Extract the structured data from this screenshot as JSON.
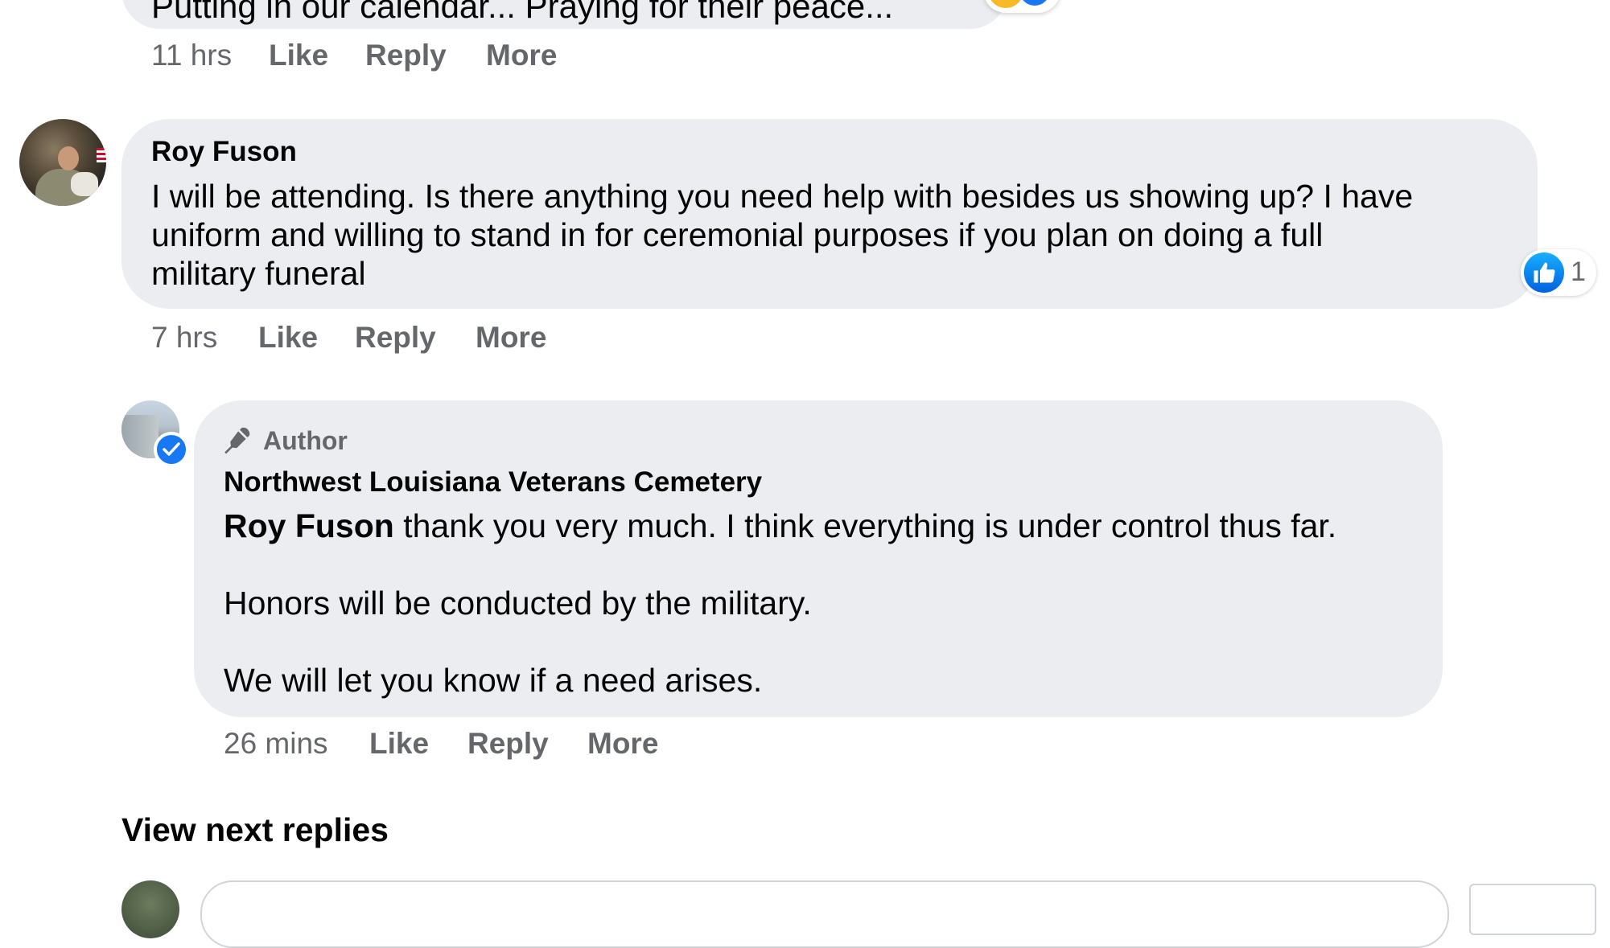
{
  "previous_comment": {
    "text_fragment": "Putting in our calendar... Praying for their peace...",
    "time": "11 hrs",
    "like_label": "Like",
    "reply_label": "Reply",
    "more_label": "More"
  },
  "comment": {
    "author": "Roy Fuson",
    "lines": [
      "I will be attending. Is there anything you need help with besides us showing up? I have",
      "uniform and willing to stand in for ceremonial purposes if you plan on doing a full",
      "military funeral"
    ],
    "reaction_count": "1",
    "time": "7 hrs",
    "like_label": "Like",
    "reply_label": "Reply",
    "more_label": "More"
  },
  "reply": {
    "badge": "Author",
    "author": "Northwest Louisiana Veterans Cemetery",
    "mention": "Roy Fuson",
    "line1_rest": " thank you very much. I think everything is under control thus far.",
    "line2": "Honors will be conducted by the military.",
    "line3": "We will let you know if a need arises.",
    "time": "26 mins",
    "like_label": "Like",
    "reply_label": "Reply",
    "more_label": "More"
  },
  "view_next_replies": "View next replies",
  "icons": {
    "author_badge": "microphone-icon",
    "verified": "verified-check-icon",
    "reaction": "like-thumb-icon"
  },
  "colors": {
    "bubble": "#ebedf0",
    "secondary_text": "#65676b",
    "accent_blue": "#1877f2"
  }
}
